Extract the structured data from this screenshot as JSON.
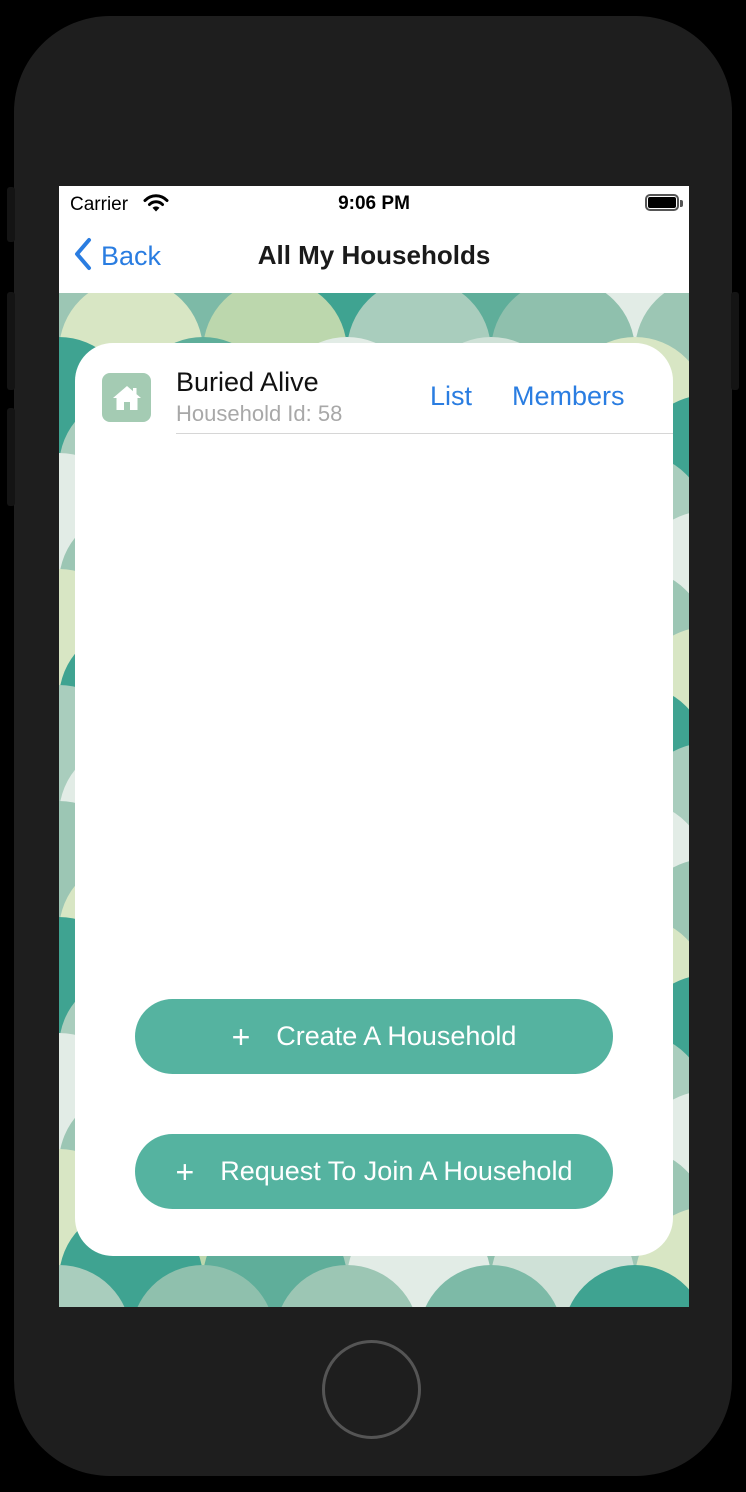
{
  "statusbar": {
    "carrier": "Carrier",
    "time": "9:06 PM"
  },
  "navbar": {
    "back_label": "Back",
    "title": "All My Households"
  },
  "households": [
    {
      "name": "Buried Alive",
      "id_text": "Household Id: 58",
      "list_label": "List",
      "members_label": "Members"
    }
  ],
  "actions": {
    "create_label": "Create A Household",
    "join_label": "Request To Join A Household",
    "plus_glyph": "+"
  },
  "colors": {
    "accent_blue": "#2a7de1",
    "button_teal": "#55b3a0",
    "house_icon_bg": "#a4cbb3"
  },
  "icons": [
    "wifi-icon",
    "battery-icon",
    "chevron-left-icon",
    "house-icon",
    "plus-icon"
  ]
}
